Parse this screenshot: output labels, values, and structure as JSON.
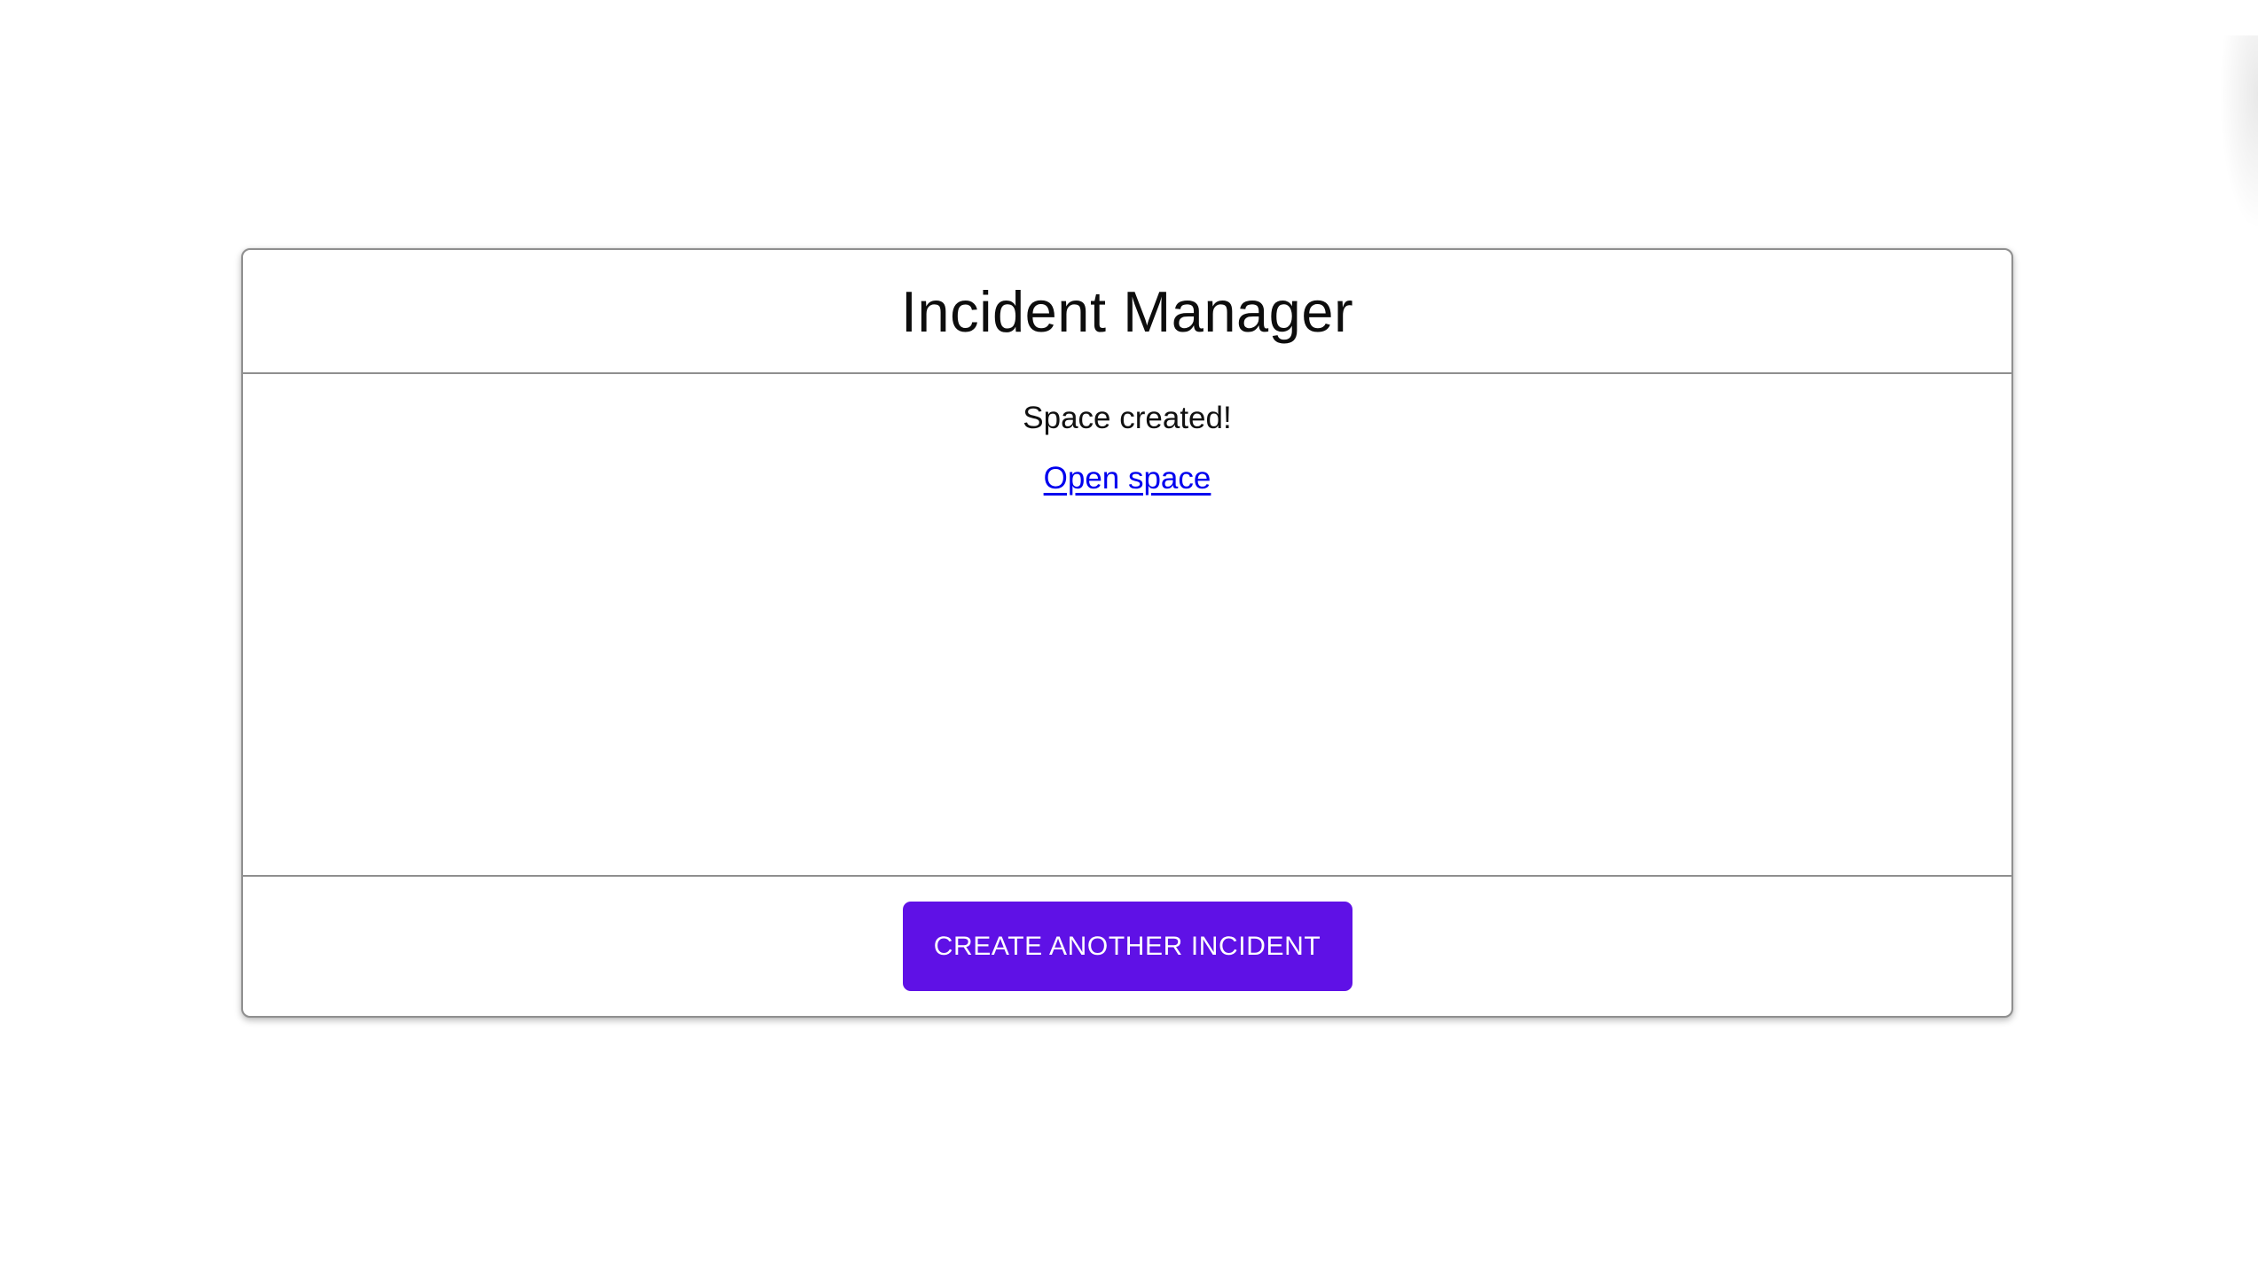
{
  "page": {
    "background_color": "#ffffff"
  },
  "card": {
    "title": "Incident Manager",
    "border_color": "#8f8f8f",
    "body": {
      "status_message": "Space created!",
      "link": {
        "label": "Open space",
        "color": "#0000ee"
      }
    },
    "footer": {
      "button": {
        "label": "CREATE ANOTHER INCIDENT",
        "background_color": "#5f11e6",
        "text_color": "#ffffff"
      }
    }
  }
}
